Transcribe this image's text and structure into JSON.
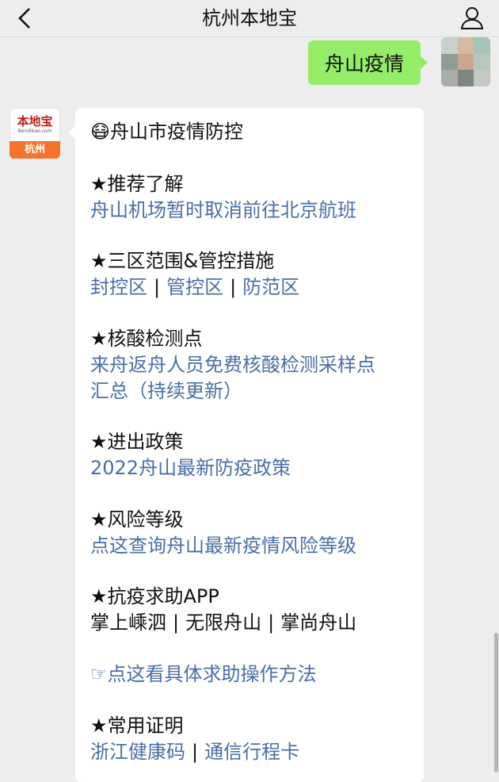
{
  "header": {
    "title": "杭州本地宝"
  },
  "user_message": {
    "text": "舟山疫情"
  },
  "bot": {
    "avatar_logo": "本地宝",
    "avatar_site": "Bendibao.com",
    "avatar_city": "杭州"
  },
  "card": {
    "title_emoji": "😷",
    "title": "舟山市疫情防控",
    "sections": [
      {
        "heading": "★推荐了解",
        "link": "舟山机场暂时取消前往北京航班"
      },
      {
        "heading": "★三区范围&管控措施",
        "links": [
          "封控区",
          "管控区",
          "防范区"
        ],
        "separator": "|"
      },
      {
        "heading": "★核酸检测点",
        "link_line1": "来舟返舟人员免费核酸检测采样点",
        "link_line2": "汇总（持续更新）"
      },
      {
        "heading": "★进出政策",
        "link": "2022舟山最新防疫政策"
      },
      {
        "heading": "★风险等级",
        "link": "点这查询舟山最新疫情风险等级"
      },
      {
        "heading": "★抗疫求助APP",
        "items": [
          "掌上嵊泗",
          "无限舟山",
          "掌尚舟山"
        ],
        "separator": "|"
      },
      {
        "hand_icon": "☞",
        "link": "点这看具体求助操作方法"
      },
      {
        "heading": "★常用证明",
        "links": [
          "浙江健康码",
          "通信行程卡"
        ],
        "separator": "|"
      }
    ]
  },
  "colors": {
    "bubble_green": "#95ec69",
    "link_blue": "#4a6fa5",
    "avatar_orange": "#f4742b",
    "logo_red": "#c21b1b"
  }
}
